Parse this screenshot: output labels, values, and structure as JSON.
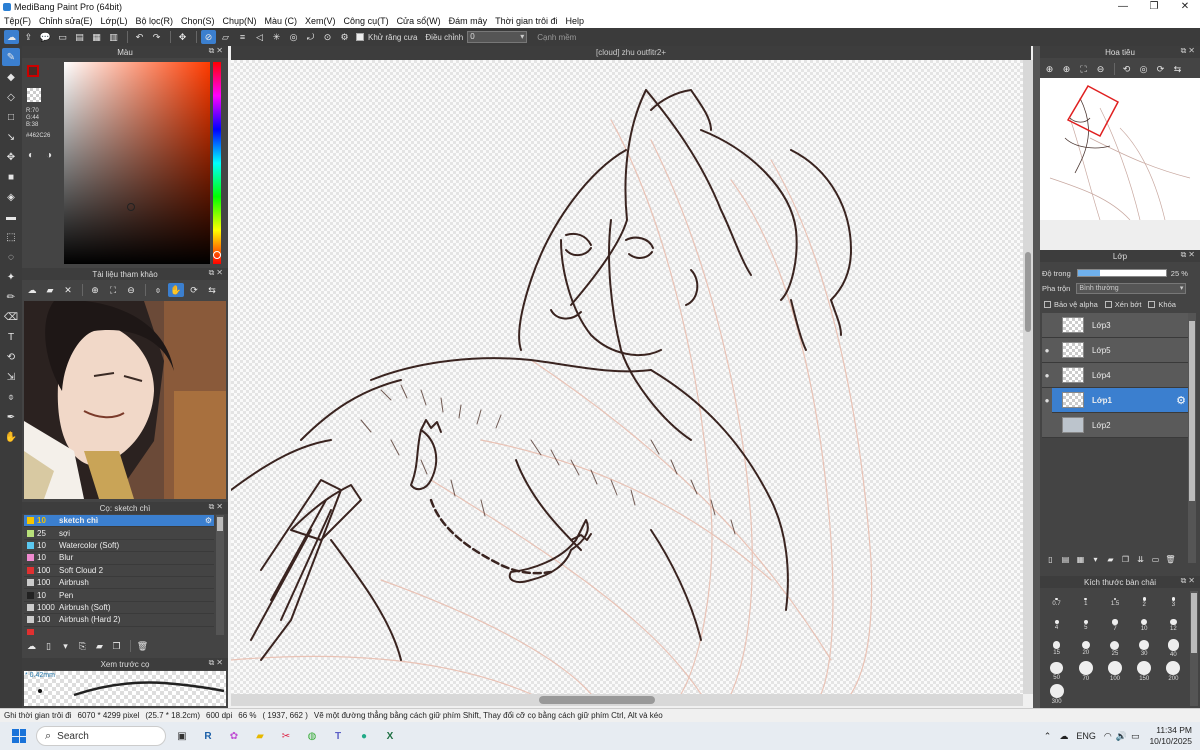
{
  "window": {
    "title": "MediBang Paint Pro (64bit)",
    "minimize": "—",
    "maximize": "❐",
    "close": "✕"
  },
  "menu": [
    "Tệp(F)",
    "Chỉnh sửa(E)",
    "Lớp(L)",
    "Bộ lọc(R)",
    "Chọn(S)",
    "Chụp(N)",
    "Màu (C)",
    "Xem(V)",
    "Công cụ(T)",
    "Cửa sổ(W)",
    "Đám mây",
    "Thời gian trôi đi",
    "Help"
  ],
  "toolbar": {
    "antialias_label": "Khử răng cưa",
    "adjust_label": "Điều chỉnh",
    "adjust_value": "0",
    "smooth_label": "Cạnh mềm"
  },
  "color_panel": {
    "title": "Màu",
    "rgb": "R:70\nG:44\nB:38",
    "hex": "#462C26",
    "fg_color": "#462c26"
  },
  "ref_panel": {
    "title": "Tài liệu tham khảo"
  },
  "brush_panel": {
    "title": "Cọ: sketch chì",
    "brushes": [
      {
        "size": "10",
        "name": "sketch chì",
        "color": "#f5c400"
      },
      {
        "size": "25",
        "name": "sợi",
        "color": "#b8e07a"
      },
      {
        "size": "10",
        "name": "Watercolor (Soft)",
        "color": "#5bc8f0"
      },
      {
        "size": "10",
        "name": "Blur",
        "color": "#f08ad0"
      },
      {
        "size": "100",
        "name": "Soft Cloud 2",
        "color": "#e03030"
      },
      {
        "size": "100",
        "name": "Airbrush",
        "color": "#cccccc"
      },
      {
        "size": "10",
        "name": "Pen",
        "color": "#222222"
      },
      {
        "size": "1000",
        "name": "Airbrush (Soft)",
        "color": "#cccccc"
      },
      {
        "size": "100",
        "name": "Airbrush (Hard 2)",
        "color": "#cccccc"
      },
      {
        "size": "",
        "name": "",
        "color": "#e03030"
      }
    ]
  },
  "preview_panel": {
    "title": "Xem trước cọ",
    "size": "* 0.42mm"
  },
  "canvas": {
    "tab": "[cloud] zhu outfitr2+"
  },
  "navigator": {
    "title": "Hoa tiêu"
  },
  "layer_panel": {
    "title": "Lớp",
    "opacity_label": "Độ trong",
    "opacity_value": "25 %",
    "opacity_fraction": 0.25,
    "blend_label": "Pha trộn",
    "blend_value": "Bình thường",
    "lock_alpha": "Bảo vệ alpha",
    "clip": "Xén bớt",
    "lock": "Khóa",
    "layers": [
      {
        "name": "Lớp3",
        "visible": ""
      },
      {
        "name": "Lớp5",
        "visible": "●"
      },
      {
        "name": "Lớp4",
        "visible": "●"
      },
      {
        "name": "Lớp1",
        "visible": "●"
      },
      {
        "name": "Lớp2",
        "visible": ""
      }
    ]
  },
  "brush_size_panel": {
    "title": "Kích thước bàn chải",
    "sizes": [
      "0.7",
      "1",
      "1.5",
      "2",
      "3",
      "4",
      "5",
      "7",
      "10",
      "12",
      "15",
      "20",
      "25",
      "30",
      "40",
      "50",
      "70",
      "100",
      "150",
      "200",
      "300"
    ]
  },
  "status": {
    "timelapse": "Ghi thời gian trôi đi",
    "dimensions": "6070 * 4299 pixel",
    "cm": "(25.7 * 18.2cm)",
    "dpi": "600 dpi",
    "zoom": "66 %",
    "coords": "( 1937, 662 )",
    "hint": "Vẽ một đường thẳng bằng cách giữ phím Shift, Thay đổi cỡ cọ bằng cách giữ phím Ctrl, Alt và kéo"
  },
  "taskbar": {
    "search": "Search",
    "lang": "ENG",
    "time": "11:34 PM",
    "date": "10/10/2025"
  }
}
